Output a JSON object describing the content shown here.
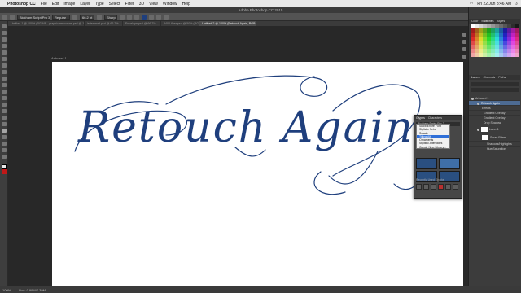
{
  "menubar": {
    "app_name": "Photoshop CC",
    "items": [
      "File",
      "Edit",
      "Image",
      "Layer",
      "Type",
      "Select",
      "Filter",
      "3D",
      "View",
      "Window",
      "Help"
    ],
    "clock": "Fri 22 Jun 8:46 AM"
  },
  "window": {
    "title": "Adobe Photoshop CC 2015"
  },
  "options_bar": {
    "font_family": "Bickham Script Pro 3",
    "font_style": "Regular",
    "font_size": "66.2 pt",
    "antialias": "Sharp"
  },
  "tabs": [
    {
      "label": "Untitled-1 @ 100% (RGB/8*)",
      "active": false
    },
    {
      "label": "graphic-resources.psd @ 100%",
      "active": false
    },
    {
      "label": "letterhead.psd @ 66.7%",
      "active": false
    },
    {
      "label": "Envelope.psd @ 66.7%",
      "active": false
    },
    {
      "label": "3400-flyer.psd @ 50% (RGB/8)",
      "active": false
    },
    {
      "label": "Untitled-2 @ 100% (Retouch Again, RGB/8*)",
      "active": true
    }
  ],
  "artboard": {
    "label": "Artboard 1"
  },
  "canvas": {
    "text": "Retouch Again",
    "text_color": "#1f3f7d"
  },
  "glyphs_panel": {
    "tabs": [
      "Glyphs",
      "Characters"
    ],
    "search_label": "Bickham Script Pro 3",
    "dropdown_options": [
      "Show Entire Font",
      "Stylistic Sets",
      "Swash",
      "Titling Alt",
      "Ornaments",
      "Stylistic Alternates",
      "Create New Library..."
    ],
    "dropdown_selected_index": 3,
    "section_label": "Alternates for Selection",
    "recent_label": "Recently Used Glyphs"
  },
  "swatches_panel": {
    "tabs": [
      "Color",
      "Swatches",
      "Styles"
    ]
  },
  "layers_panel": {
    "tabs": [
      "Layers",
      "Channels",
      "Paths"
    ],
    "artboard": "Artboard 1",
    "layers": [
      {
        "name": "Retouch Again",
        "selected": true
      },
      {
        "name": "Effects",
        "selected": false
      },
      {
        "name": "Gradient Overlay",
        "selected": false
      },
      {
        "name": "Gradient Overlay",
        "selected": false
      },
      {
        "name": "Drop Shadow",
        "selected": false
      },
      {
        "name": "Layer 1",
        "selected": false
      },
      {
        "name": "Smart Filters",
        "selected": false
      },
      {
        "name": "Shadows/Highlights",
        "selected": false
      },
      {
        "name": "Hue/Saturation",
        "selected": false
      }
    ]
  },
  "status_bar": {
    "zoom": "100%",
    "doc": "Doc: 0.99M/7.39M"
  }
}
